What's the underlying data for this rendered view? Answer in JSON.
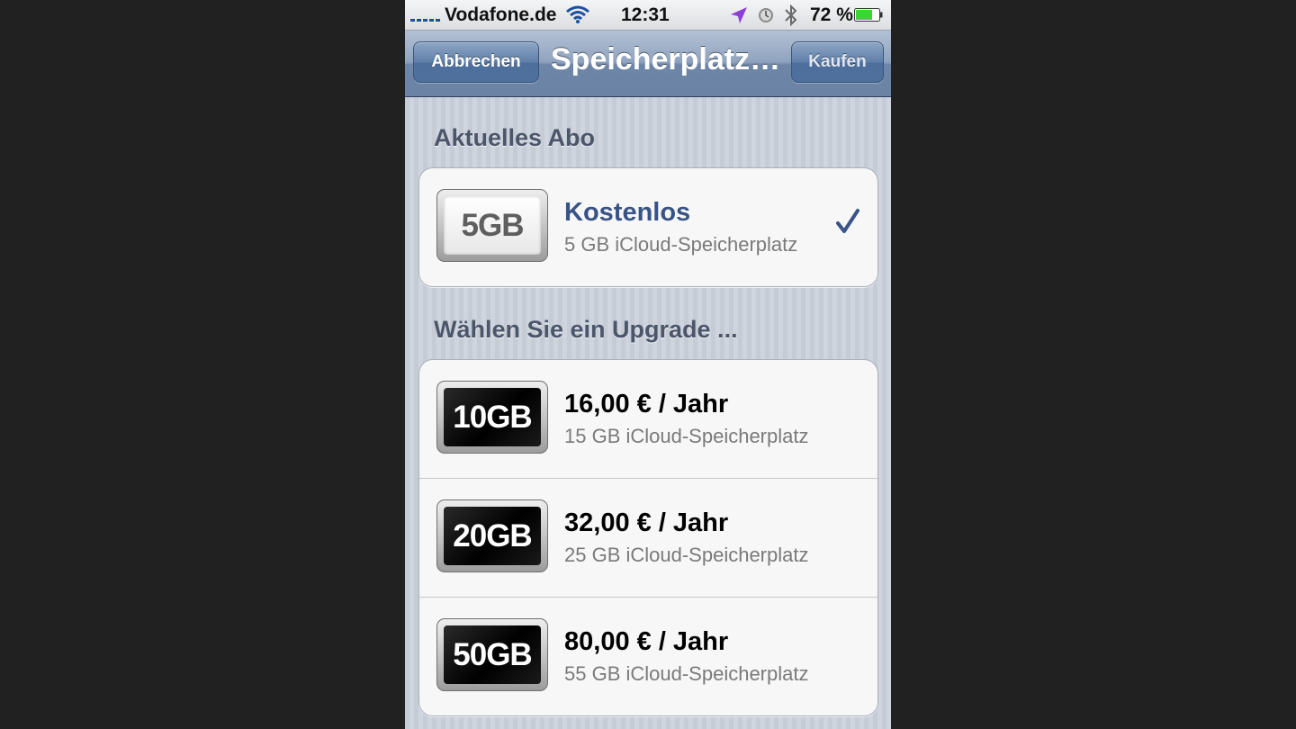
{
  "colors": {
    "background": "#212121",
    "nav_bar": "#7089ab",
    "section_header": "#4c566a",
    "current_plan_text": "#385487",
    "signal_blue": "#1d4fa0",
    "battery_green": "#3fd33a",
    "location_purple": "#8e3ed8"
  },
  "status_bar": {
    "carrier": "Vodafone.de",
    "time": "12:31",
    "battery_percent": "72 %",
    "battery_level": 0.72,
    "icons": [
      "signal-icon",
      "wifi-icon",
      "location-arrow-icon",
      "alarm-clock-icon",
      "bluetooth-icon",
      "battery-icon"
    ]
  },
  "nav_bar": {
    "cancel_label": "Abbrechen",
    "title": "Speicherplatz…",
    "buy_label": "Kaufen"
  },
  "current_section": {
    "header": "Aktuelles Abo",
    "plan": {
      "badge": "5GB",
      "title": "Kostenlos",
      "subtitle": "5 GB iCloud-Speicherplatz",
      "selected": true,
      "check_icon": "checkmark-icon"
    }
  },
  "upgrade_section": {
    "header": "Wählen Sie ein Upgrade ...",
    "plans": [
      {
        "badge": "10GB",
        "price": "16,00 € / Jahr",
        "subtitle": "15 GB iCloud-Speicherplatz"
      },
      {
        "badge": "20GB",
        "price": "32,00 € / Jahr",
        "subtitle": "25 GB iCloud-Speicherplatz"
      },
      {
        "badge": "50GB",
        "price": "80,00 € / Jahr",
        "subtitle": "55 GB iCloud-Speicherplatz"
      }
    ]
  }
}
